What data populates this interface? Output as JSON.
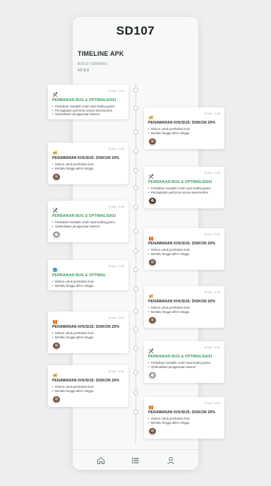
{
  "app": {
    "title": "SD107"
  },
  "header": {
    "heading": "TIMELINE APK",
    "build_label": "BUILD TERBARU",
    "build_version": "V2.3.0"
  },
  "cards_left": [
    {
      "icon": "hammer-wrench-icon",
      "date": "30 Jan / 11:00",
      "title": "PERBAIKAN BUG & OPTIMALISASI",
      "title_style": "green",
      "items": [
        "Perbaikan masalah crash saat loading game",
        "Peningkatan performa secara keseluruhan",
        "Optimalisasi penggunaan baterai"
      ],
      "avatar": false
    },
    {
      "icon": "megaphone-icon",
      "date": "30 Jan / 11:00",
      "title": "PENAWARAN KHUSUS: DISKON 20%",
      "title_style": "dark",
      "items": [
        "Diskon untuk pembelian koin",
        "Berlaku hingga akhir minggu"
      ],
      "avatar": "a"
    },
    {
      "icon": "hammer-wrench-icon",
      "date": "30 Jan / 11:00",
      "title": "PERBAIKAN BUG & OPTIMALISASI",
      "title_style": "green",
      "items": [
        "Perbaikan masalah crash saat loading game",
        "Optimalisasi penggunaan baterai"
      ],
      "avatar": "c"
    },
    {
      "icon": "globe-icon",
      "date": "18 Jan / 11:00",
      "title": "PERBAIKAN BUG & OPTIMAL",
      "title_style": "green",
      "items": [
        "Diskon untuk pembelian koin",
        "Berlaku hingga akhir minggu"
      ],
      "avatar": false
    },
    {
      "icon": "gift-icon",
      "date": "20 Jan / 11:00",
      "title": "PENAWARAN KHUSUS: DISKON 20%",
      "title_style": "dark",
      "items": [
        "Diskon untuk pembelian koin",
        "Berlaku hingga akhir minggu"
      ],
      "avatar": "a"
    },
    {
      "icon": "megaphone-icon",
      "date": "30 Jan / 11:00",
      "title": "PENAWARAN KHUSUS: DISKON 20%",
      "title_style": "dark",
      "items": [
        "Diskon untuk pembelian koin",
        "Berlaku hingga akhir minggu"
      ],
      "avatar": "a"
    }
  ],
  "cards_right": [
    {
      "icon": "megaphone-icon",
      "date": "30 Jan / 11:00",
      "title": "PENAWARAN KHUSUS: DISKON 20%",
      "title_style": "dark",
      "items": [
        "Diskon untuk pembelian koin",
        "Berlaku hingga akhir minggu"
      ],
      "avatar": "a"
    },
    {
      "icon": "hammer-wrench-icon",
      "date": "30 Jan / 11:00",
      "title": "PERBAIKAN BUG & OPTIMALISASI",
      "title_style": "green",
      "items": [
        "Perbaikan masalah crash saat loading game",
        "Peningkatan performa secara keseluruhan"
      ],
      "avatar": "b"
    },
    {
      "icon": "gift-icon",
      "date": "30 Jan / 11:00",
      "title": "PENAWARAN KHUSUS: DISKON 20%",
      "title_style": "dark",
      "items": [
        "Diskon untuk pembelian koin",
        "Berlaku hingga akhir minggu"
      ],
      "avatar": "a"
    },
    {
      "icon": "megaphone-icon",
      "date": "30 Jan / 11:00",
      "title": "PENAWARAN KHUSUS: DISKON 20%",
      "title_style": "dark",
      "items": [
        "Diskon untuk pembelian koin",
        "Berlaku hingga akhir minggu"
      ],
      "avatar": "a"
    },
    {
      "icon": "hammer-wrench-icon",
      "date": "30 Jan / 11:00",
      "title": "PERBAIKAN BUG & OPTIMALISASI",
      "title_style": "green",
      "items": [
        "Perbaikan masalah crash saat loading game",
        "Optimalisasi penggunaan baterai"
      ],
      "avatar": "c"
    },
    {
      "icon": "gift-icon",
      "date": "10 Jan / 11:00",
      "title": "PENAWARAN KHUSUS: DISKON 20%",
      "title_style": "dark",
      "items": [
        "Diskon untuk pembelian koin",
        "Berlaku hingga akhir minggu"
      ],
      "avatar": "a"
    }
  ],
  "nav": [
    {
      "icon": "home-icon"
    },
    {
      "icon": "list-icon"
    },
    {
      "icon": "profile-icon"
    }
  ],
  "colors": {
    "accent_green": "#3b9a5a",
    "background": "#eceeef",
    "card": "#ffffff"
  }
}
